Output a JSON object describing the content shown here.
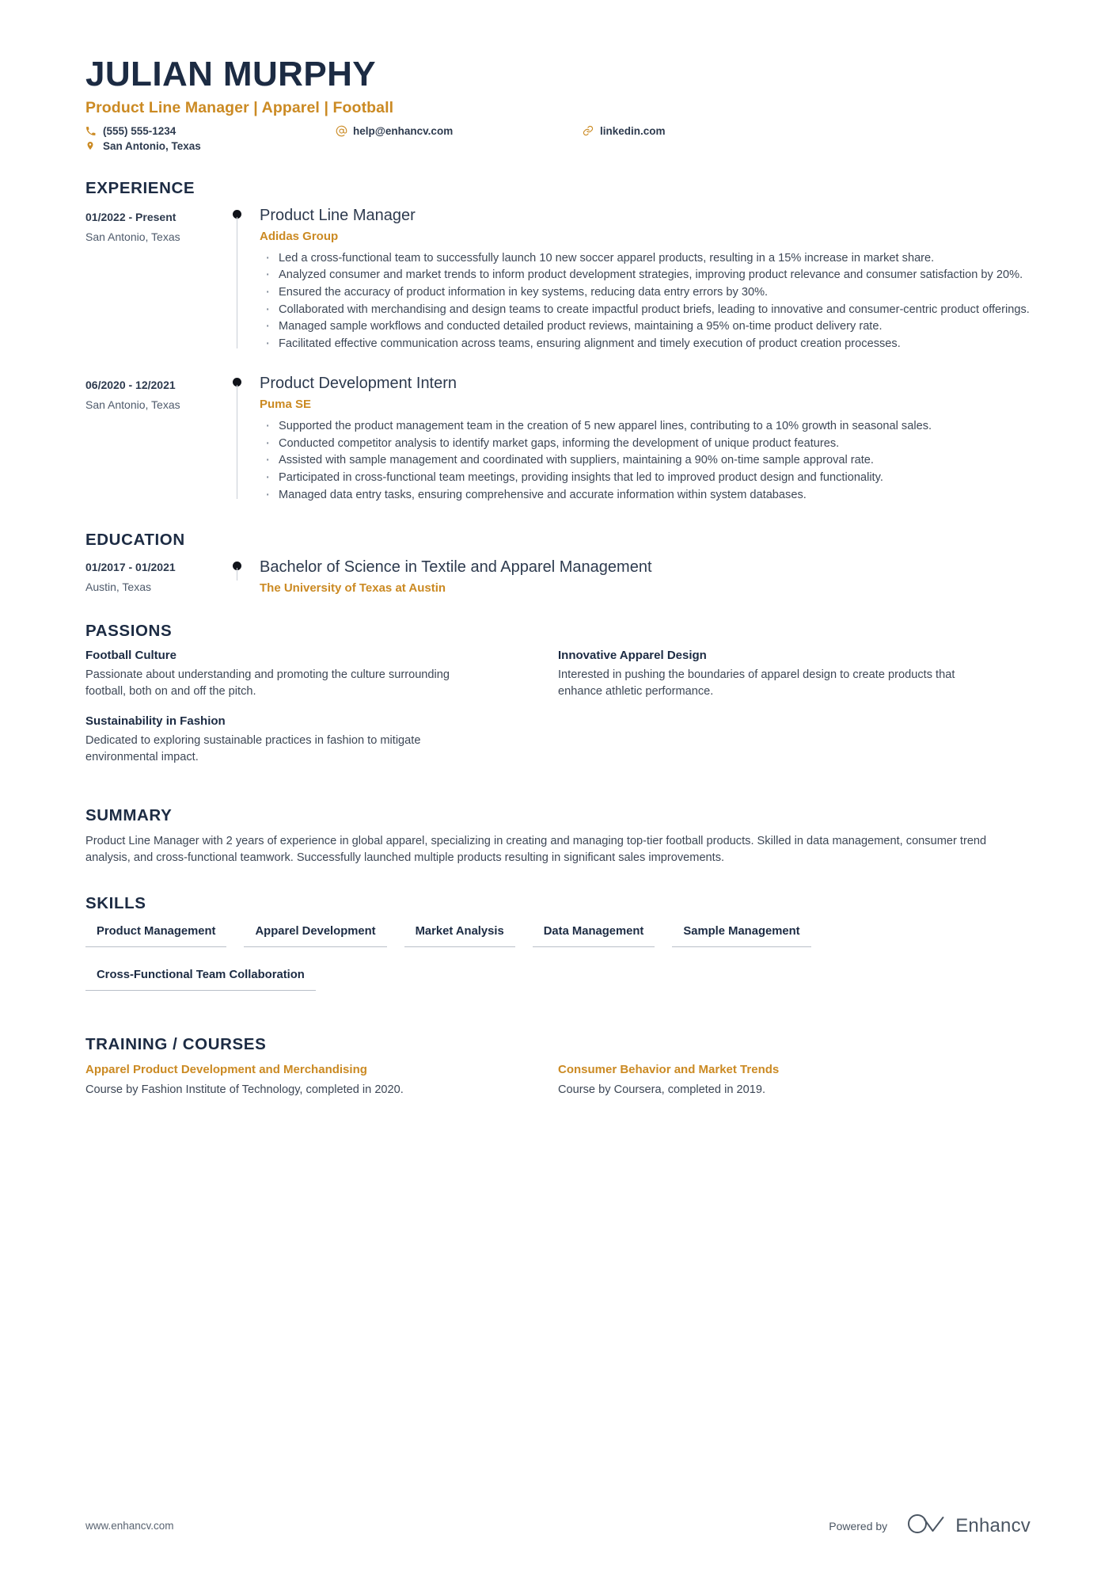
{
  "header": {
    "name": "JULIAN MURPHY",
    "headline": "Product Line Manager | Apparel | Football",
    "phone": "(555) 555-1234",
    "email": "help@enhancv.com",
    "website": "linkedin.com",
    "location": "San Antonio, Texas",
    "icons": {
      "phone": "phone-icon",
      "email": "at-sign-icon",
      "link": "link-icon",
      "location": "map-pin-icon"
    }
  },
  "accent_color": "#cb8a23",
  "dark_color": "#1c2b43",
  "sections": {
    "experience_title": "EXPERIENCE",
    "education_title": "EDUCATION",
    "passions_title": "PASSIONS",
    "summary_title": "SUMMARY",
    "skills_title": "SKILLS",
    "courses_title": "TRAINING / COURSES"
  },
  "experience": [
    {
      "date": "01/2022 - Present",
      "location": "San Antonio, Texas",
      "role": "Product Line Manager",
      "company": "Adidas Group",
      "bullets": [
        "Led a cross-functional team to successfully launch 10 new soccer apparel products, resulting in a 15% increase in market share.",
        "Analyzed consumer and market trends to inform product development strategies, improving product relevance and consumer satisfaction by 20%.",
        "Ensured the accuracy of product information in key systems, reducing data entry errors by 30%.",
        "Collaborated with merchandising and design teams to create impactful product briefs, leading to innovative and consumer-centric product offerings.",
        "Managed sample workflows and conducted detailed product reviews, maintaining a 95% on-time product delivery rate.",
        "Facilitated effective communication across teams, ensuring alignment and timely execution of product creation processes."
      ]
    },
    {
      "date": "06/2020 - 12/2021",
      "location": "San Antonio, Texas",
      "role": "Product Development Intern",
      "company": "Puma SE",
      "bullets": [
        "Supported the product management team in the creation of 5 new apparel lines, contributing to a 10% growth in seasonal sales.",
        "Conducted competitor analysis to identify market gaps, informing the development of unique product features.",
        "Assisted with sample management and coordinated with suppliers, maintaining a 90% on-time sample approval rate.",
        "Participated in cross-functional team meetings, providing insights that led to improved product design and functionality.",
        "Managed data entry tasks, ensuring comprehensive and accurate information within system databases."
      ]
    }
  ],
  "education": [
    {
      "date": "01/2017 - 01/2021",
      "location": "Austin, Texas",
      "degree": "Bachelor of Science in Textile and Apparel Management",
      "school": "The University of Texas at Austin"
    }
  ],
  "passions": [
    {
      "title": "Football Culture",
      "text": "Passionate about understanding and promoting the culture surrounding football, both on and off the pitch."
    },
    {
      "title": "Innovative Apparel Design",
      "text": "Interested in pushing the boundaries of apparel design to create products that enhance athletic performance."
    },
    {
      "title": "Sustainability in Fashion",
      "text": "Dedicated to exploring sustainable practices in fashion to mitigate environmental impact."
    }
  ],
  "summary": "Product Line Manager with 2 years of experience in global apparel, specializing in creating and managing top-tier football products. Skilled in data management, consumer trend analysis, and cross-functional teamwork. Successfully launched multiple products resulting in significant sales improvements.",
  "skills": [
    "Product Management",
    "Apparel Development",
    "Market Analysis",
    "Data Management",
    "Sample Management",
    "Cross-Functional Team Collaboration"
  ],
  "courses": [
    {
      "title": "Apparel Product Development and Merchandising",
      "text": "Course by Fashion Institute of Technology, completed in 2020."
    },
    {
      "title": "Consumer Behavior and Market Trends",
      "text": "Course by Coursera, completed in 2019."
    }
  ],
  "footer": {
    "url": "www.enhancv.com",
    "powered_by": "Powered by",
    "brand": "Enhancv"
  }
}
